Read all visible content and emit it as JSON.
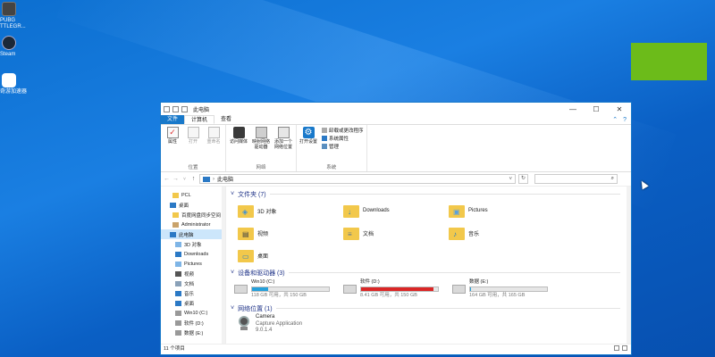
{
  "desktop": {
    "icons": [
      {
        "label": "PUBG\nTTLEGR...",
        "icon": "pubg-icon",
        "color": "#444444"
      },
      {
        "label": "Steam",
        "icon": "steam-icon",
        "color": "#1b2838"
      },
      {
        "label": "奇游加速器",
        "icon": "booster-icon",
        "color": "#ffffff"
      }
    ],
    "tile_color": "#6cbb1a"
  },
  "window": {
    "title": "此电脑",
    "controls": {
      "minimize": "—",
      "maximize": "☐",
      "close": "✕"
    },
    "ribbon_tabs": {
      "file": "文件",
      "computer": "计算机",
      "view": "查看"
    },
    "ribbon": {
      "location_group": {
        "label": "位置",
        "properties": "属性",
        "open": "打开",
        "rename": "重命名"
      },
      "network_group": {
        "label": "网络",
        "access_media": "访问媒体",
        "map_drive": "映射网络驱动器",
        "add_location": "添加一个网络位置"
      },
      "system_group": {
        "label": "系统",
        "open_settings": "打开设置",
        "uninstall": "卸载或更改程序",
        "sys_props": "系统属性",
        "manage": "管理"
      }
    },
    "address": {
      "path": "此电脑",
      "search_placeholder": ""
    },
    "sidebar": {
      "items": [
        {
          "label": "PCL",
          "icon": "folder-icon",
          "color": "#f2c84b"
        },
        {
          "label": "桌面",
          "icon": "desktop-icon",
          "color": "#2b79c5"
        },
        {
          "label": "百度网盘同步空间",
          "icon": "folder-icon",
          "color": "#f2c84b"
        },
        {
          "label": "Administrator",
          "icon": "user-icon",
          "color": "#c9a36b"
        },
        {
          "label": "此电脑",
          "icon": "computer-icon",
          "color": "#2b79c5"
        },
        {
          "label": "3D 对象",
          "icon": "3d-objects-icon",
          "color": "#7fb5e6"
        },
        {
          "label": "Downloads",
          "icon": "downloads-icon",
          "color": "#2b79c5"
        },
        {
          "label": "Pictures",
          "icon": "pictures-icon",
          "color": "#7fb5e6"
        },
        {
          "label": "视频",
          "icon": "videos-icon",
          "color": "#555555"
        },
        {
          "label": "文档",
          "icon": "documents-icon",
          "color": "#8aa1b8"
        },
        {
          "label": "音乐",
          "icon": "music-icon",
          "color": "#2b79c5"
        },
        {
          "label": "桌面",
          "icon": "desktop-icon",
          "color": "#2b79c5"
        },
        {
          "label": "Win10 (C:)",
          "icon": "drive-icon",
          "color": "#999999"
        },
        {
          "label": "软件 (D:)",
          "icon": "drive-icon",
          "color": "#999999"
        },
        {
          "label": "数据 (E:)",
          "icon": "drive-icon",
          "color": "#999999"
        }
      ]
    },
    "sections": {
      "folders_title": "文件夹 (7)",
      "devices_title": "设备和驱动器 (3)",
      "network_title": "网络位置 (1)"
    },
    "folders": [
      {
        "label": "3D 对象",
        "icon": "3d-objects-icon",
        "glyph": "◈"
      },
      {
        "label": "Downloads",
        "icon": "downloads-icon",
        "glyph": "↓"
      },
      {
        "label": "Pictures",
        "icon": "pictures-icon",
        "glyph": "▣"
      },
      {
        "label": "视频",
        "icon": "videos-icon",
        "glyph": "▤"
      },
      {
        "label": "文档",
        "icon": "documents-icon",
        "glyph": "≡"
      },
      {
        "label": "音乐",
        "icon": "music-icon",
        "glyph": "♪"
      },
      {
        "label": "桌面",
        "icon": "desktop-icon",
        "glyph": "▭"
      }
    ],
    "drives": [
      {
        "name": "Win10 (C:)",
        "sizes": "118 GB 可用，共 150 GB",
        "used_fraction": 0.21,
        "bar_color": "#26a0da"
      },
      {
        "name": "软件 (D:)",
        "sizes": "8.41 GB 可用，共 150 GB",
        "used_fraction": 0.94,
        "bar_color": "#da2626"
      },
      {
        "name": "数据 (E:)",
        "sizes": "164 GB 可用，共 165 GB",
        "used_fraction": 0.01,
        "bar_color": "#26a0da"
      }
    ],
    "network_items": [
      {
        "name": "Camera",
        "sub1": "Capture Application",
        "sub2": "9.0.1.4"
      }
    ],
    "status": {
      "count": "11 个项目"
    }
  }
}
